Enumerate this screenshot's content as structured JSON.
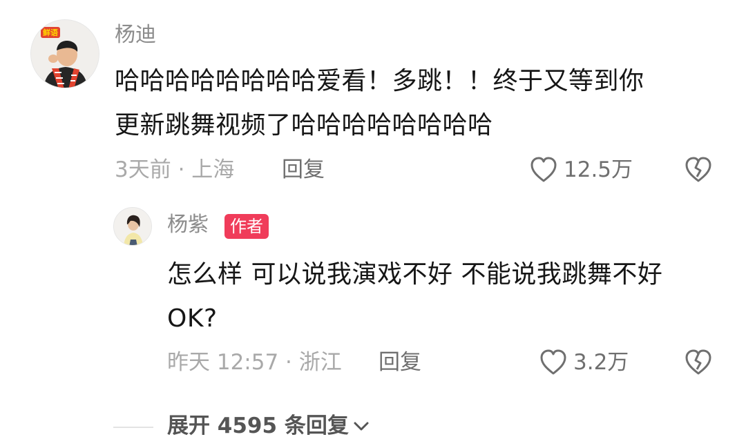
{
  "comment": {
    "username": "杨迪",
    "lines": [
      "哈哈哈哈哈哈哈哈爱看！多跳！！终于又等到你",
      "更新跳舞视频了哈哈哈哈哈哈哈哈"
    ],
    "meta": "3天前 · 上海",
    "reply_label": "回复",
    "likes": "12.5万",
    "avatar_icon": "avatar-man-red-scarf",
    "avatar_badge_text": "鲜语"
  },
  "reply": {
    "username": "杨紫",
    "badge": "作者",
    "lines": [
      "怎么样 可以说我演戏不好 不能说我跳舞不好",
      "OK?"
    ],
    "meta": "昨天 12:57 · 浙江",
    "reply_label": "回复",
    "likes": "3.2万",
    "avatar_icon": "avatar-woman"
  },
  "expand": {
    "label": "展开 4595 条回复",
    "icon": "chevron-down-icon"
  },
  "colors": {
    "badge": "#f03c5a",
    "meta": "#a9a9a9",
    "username": "#8c8c8c"
  }
}
